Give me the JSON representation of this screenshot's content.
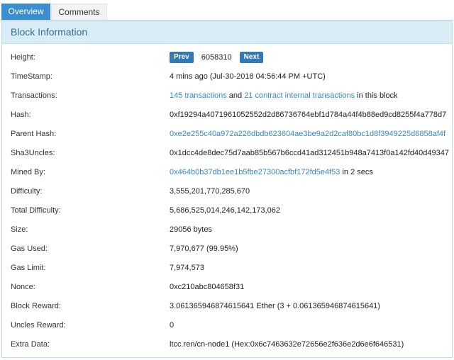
{
  "tabs": {
    "overview": "Overview",
    "comments": "Comments"
  },
  "panel": {
    "title": "Block Information"
  },
  "rows": {
    "height": {
      "label": "Height:",
      "prev": "Prev",
      "value": "6058310",
      "next": "Next"
    },
    "timestamp": {
      "label": "TimeStamp:",
      "value": "4 mins ago (Jul-30-2018 04:56:44 PM +UTC)"
    },
    "transactions": {
      "label": "Transactions:",
      "tx_link": "145 transactions",
      "and": " and ",
      "internal_link": "21 contract internal transactions",
      "suffix": " in this block"
    },
    "hash": {
      "label": "Hash:",
      "value": "0xf19294a4071961052552d2d86736764ebf1d784a44f4b88ed9cd8255f4a778d7"
    },
    "parent_hash": {
      "label": "Parent Hash:",
      "value": "0xe2e255c40a972a226dbdb623604ae3be9a2d2caf80bc1d8f3949225d6858af4f"
    },
    "sha3uncles": {
      "label": "Sha3Uncles:",
      "value": "0x1dcc4de8dec75d7aab85b567b6ccd41ad312451b948a7413f0a142fd40d49347"
    },
    "mined_by": {
      "label": "Mined By:",
      "link": "0x464b0b37db1ee1b5fbe27300acfbf172fd5e4f53",
      "suffix": " in 2 secs"
    },
    "difficulty": {
      "label": "Difficulty:",
      "value": "3,555,201,770,285,670"
    },
    "total_difficulty": {
      "label": "Total Difficulty:",
      "value": "5,686,525,014,246,142,173,062"
    },
    "size": {
      "label": "Size:",
      "value": "29056 bytes"
    },
    "gas_used": {
      "label": "Gas Used:",
      "value": "7,970,677 (99.95%)"
    },
    "gas_limit": {
      "label": "Gas Limit:",
      "value": "7,974,573"
    },
    "nonce": {
      "label": "Nonce:",
      "value": "0xc210abc804658f31"
    },
    "block_reward": {
      "label": "Block Reward:",
      "value": "3.061365946874615641 Ether (3 + 0.061365946874615641)"
    },
    "uncles_reward": {
      "label": "Uncles Reward:",
      "value": "0"
    },
    "extra_data": {
      "label": "Extra Data:",
      "value": "ltcc.ren/cn-node1 (Hex:0x6c7463632e72656e2f636e2d6e6f646531)"
    }
  },
  "colors": {
    "tab_active": "#3b8fd0",
    "heading_bg": "#d9edf7",
    "heading_text": "#31708f",
    "link": "#3a87c8",
    "button": "#3379b7"
  }
}
